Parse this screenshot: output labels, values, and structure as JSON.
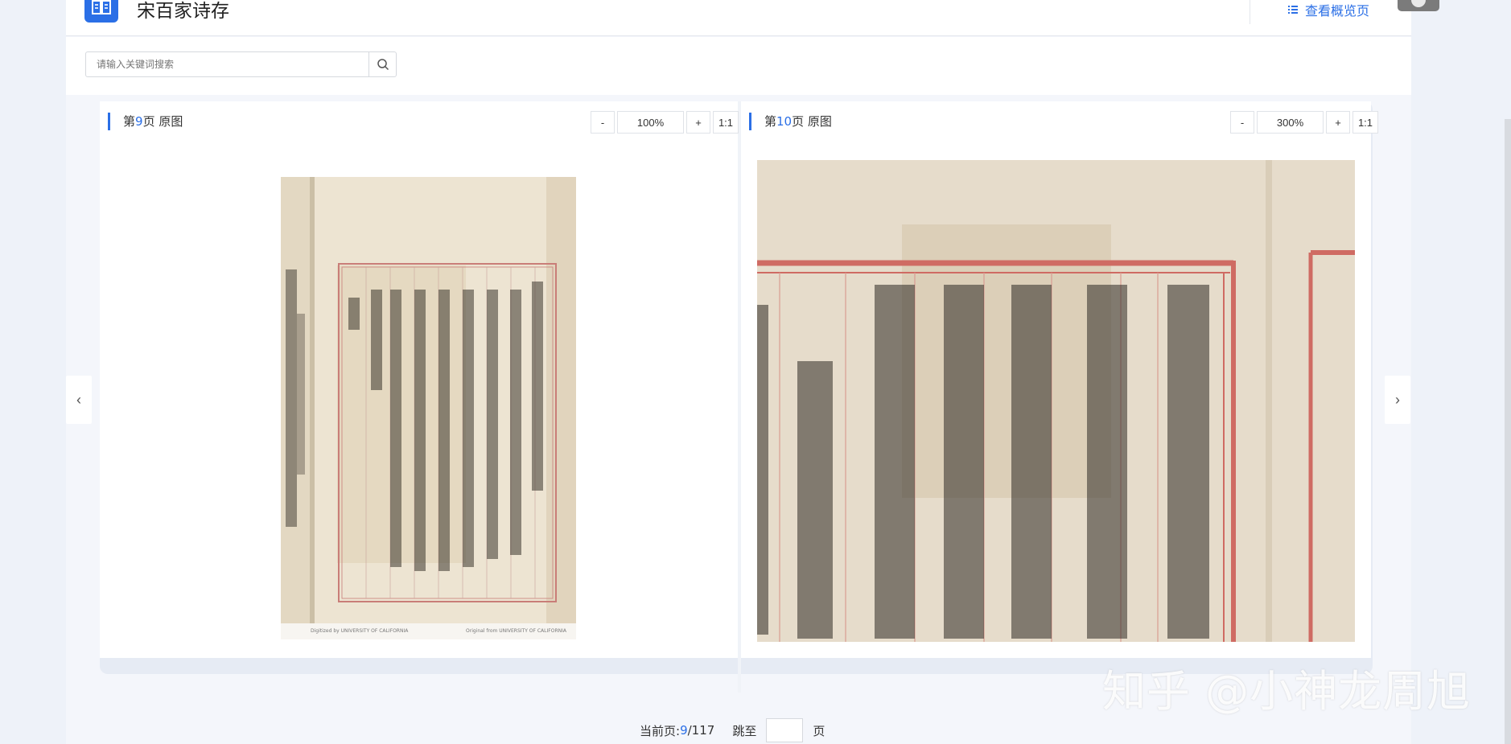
{
  "header": {
    "title": "宋百家诗存",
    "overview_label": "查看概览页"
  },
  "search": {
    "placeholder": "请输入关键词搜索"
  },
  "left_page": {
    "prefix": "第",
    "page_number": "9",
    "suffix": "页 原图",
    "zoom_minus": "-",
    "zoom_value": "100%",
    "zoom_plus": "+",
    "zoom_reset": "1:1",
    "footer_left": "Digitized by UNIVERSITY OF CALIFORNIA",
    "footer_right": "Original from UNIVERSITY OF CALIFORNIA"
  },
  "right_page": {
    "prefix": "第",
    "page_number": "10",
    "suffix": "页 原图",
    "zoom_minus": "-",
    "zoom_value": "300%",
    "zoom_plus": "+",
    "zoom_reset": "1:1"
  },
  "nav": {
    "prev": "‹",
    "next": "›"
  },
  "pagination": {
    "current_label": "当前页:",
    "current": "9",
    "separator": "/",
    "total": "117",
    "jump_label": "跳至",
    "page_unit": "页"
  },
  "watermark": "知乎 @小神龙周旭",
  "colors": {
    "accent": "#2b6fe6",
    "background": "#eef2f9"
  }
}
